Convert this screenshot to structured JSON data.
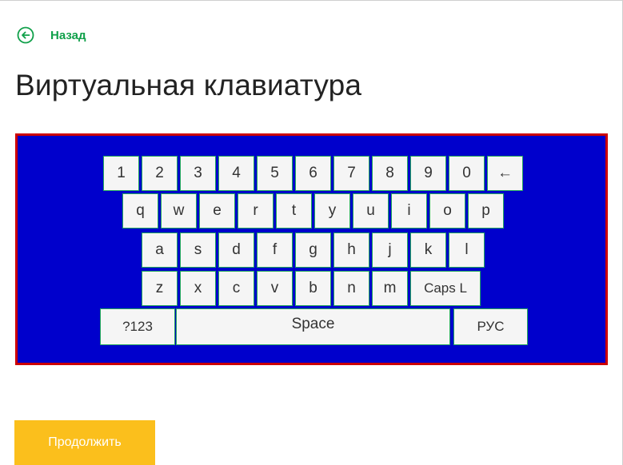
{
  "back": {
    "label": "Назад",
    "icon": "arrow-left-circle-icon",
    "color": "#10a04a"
  },
  "page": {
    "title": "Виртуальная клавиатура"
  },
  "keyboard": {
    "panel_bg": "#0000cc",
    "panel_border": "#cc0000",
    "key_border": "#22a75d",
    "rows": [
      [
        "1",
        "2",
        "3",
        "4",
        "5",
        "6",
        "7",
        "8",
        "9",
        "0",
        "←"
      ],
      [
        "q",
        "w",
        "e",
        "r",
        "t",
        "y",
        "u",
        "i",
        "o",
        "p"
      ],
      [
        "a",
        "s",
        "d",
        "f",
        "g",
        "h",
        "j",
        "k",
        "l"
      ],
      [
        "z",
        "x",
        "c",
        "v",
        "b",
        "n",
        "m",
        "Caps L"
      ],
      [
        "?123",
        "Space",
        "РУС"
      ]
    ]
  },
  "footer": {
    "continue_label": "Продолжить",
    "continue_color": "#fbbf1c"
  }
}
